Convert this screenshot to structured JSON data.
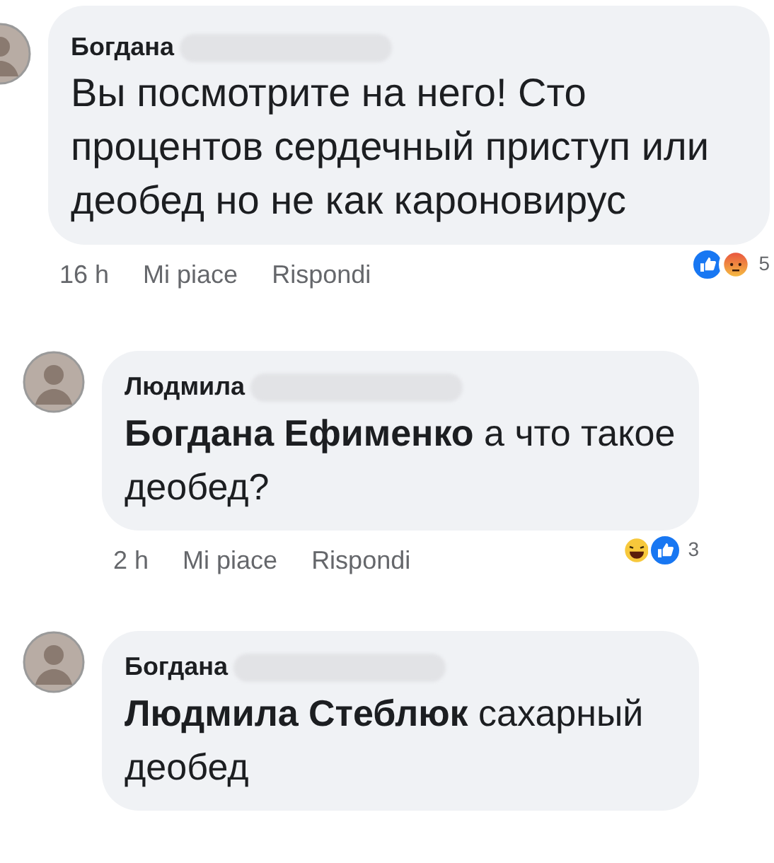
{
  "comments": [
    {
      "author": "Богдана",
      "text": "Вы посмотрите на него! Сто процентов сердечный приступ или деобед но не как кароновирус",
      "time": "16 h",
      "like": "Mi piace",
      "reply": "Rispondi",
      "reactions": [
        {
          "kind": "like"
        },
        {
          "kind": "angry"
        }
      ],
      "reaction_count": "5",
      "children": [
        {
          "author": "Людмила",
          "text": "**Богдана Ефименко** а что такое деобед?",
          "time": "2 h",
          "like": "Mi piace",
          "reply": "Rispondi",
          "reactions": [
            {
              "kind": "haha"
            },
            {
              "kind": "like"
            }
          ],
          "reaction_count": "3"
        },
        {
          "author": "Богдана",
          "text": "**Людмила Стеблюк** сахарный деобед"
        }
      ]
    }
  ]
}
